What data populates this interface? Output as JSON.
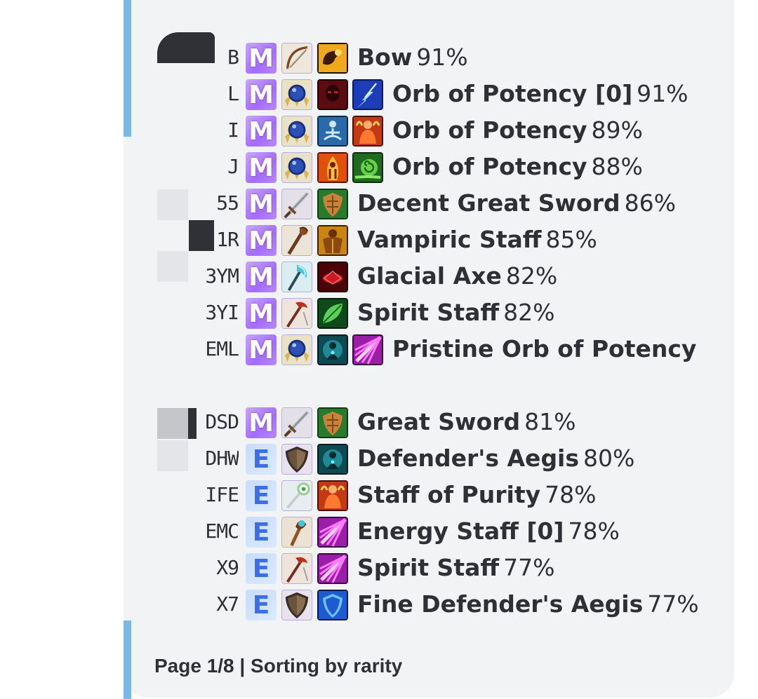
{
  "rows": [
    {
      "code": "B",
      "rarity": "m",
      "weapon": "bow",
      "ab1": "muscle",
      "ab2": null,
      "name": "Bow",
      "pct": "91%"
    },
    {
      "code": "L",
      "rarity": "m",
      "weapon": "orb",
      "ab1": "dark-face",
      "ab2": "lightning",
      "name": "Orb of Potency [0]",
      "pct": "91%"
    },
    {
      "code": "I",
      "rarity": "m",
      "weapon": "orb",
      "ab1": "meditate",
      "ab2": "fire-man",
      "name": "Orb of Potency",
      "pct": "89%"
    },
    {
      "code": "J",
      "rarity": "m",
      "weapon": "orb",
      "ab1": "flame-figure",
      "ab2": "snail",
      "name": "Orb of Potency",
      "pct": "88%"
    },
    {
      "code": "55",
      "rarity": "m",
      "weapon": "sword",
      "ab1": "shield-leaf",
      "ab2": null,
      "name": "Decent Great Sword",
      "pct": "86%"
    },
    {
      "code": "1R",
      "rarity": "m",
      "weapon": "staff",
      "ab1": "strong-man",
      "ab2": null,
      "name": "Vampiric Staff",
      "pct": "85%"
    },
    {
      "code": "3YM",
      "rarity": "m",
      "weapon": "axe",
      "ab1": "red-glow",
      "ab2": null,
      "name": "Glacial Axe",
      "pct": "82%"
    },
    {
      "code": "3YI",
      "rarity": "m",
      "weapon": "red-staff",
      "ab1": "leaf",
      "ab2": null,
      "name": "Spirit Staff",
      "pct": "82%"
    },
    {
      "code": "EML",
      "rarity": "m",
      "weapon": "orb",
      "ab1": "teal-figure",
      "ab2": "pink-burst",
      "name": "Pristine Orb of Potency",
      "pct": ""
    },
    {
      "code": "DSD",
      "rarity": "m",
      "weapon": "sword",
      "ab1": "shield-leaf",
      "ab2": null,
      "name": "Great Sword",
      "pct": "81%"
    },
    {
      "code": "DHW",
      "rarity": "e",
      "weapon": "shield",
      "ab1": "teal-figure",
      "ab2": null,
      "name": "Defender's Aegis",
      "pct": "80%"
    },
    {
      "code": "IFE",
      "rarity": "e",
      "weapon": "wand",
      "ab1": "fire-man",
      "ab2": null,
      "name": "Staff of Purity",
      "pct": "78%"
    },
    {
      "code": "EMC",
      "rarity": "e",
      "weapon": "gem-staff",
      "ab1": "pink-burst",
      "ab2": null,
      "name": "Energy Staff [0]",
      "pct": "78%"
    },
    {
      "code": "X9",
      "rarity": "e",
      "weapon": "red-staff",
      "ab1": "pink-burst",
      "ab2": null,
      "name": "Spirit Staff",
      "pct": "77%"
    },
    {
      "code": "X7",
      "rarity": "e",
      "weapon": "shield",
      "ab1": "blue-shield",
      "ab2": null,
      "name": "Fine Defender's Aegis",
      "pct": "77%"
    }
  ],
  "rarity_letters": {
    "m": "M",
    "e": "E"
  },
  "footer": {
    "page": "Page 1/8",
    "separator": " | ",
    "sort": "Sorting by rarity"
  },
  "colors": {
    "accent": "#7cb8e4",
    "mythic": "#a46cff",
    "epic": "#3e6ee6",
    "text": "#2e3035"
  }
}
